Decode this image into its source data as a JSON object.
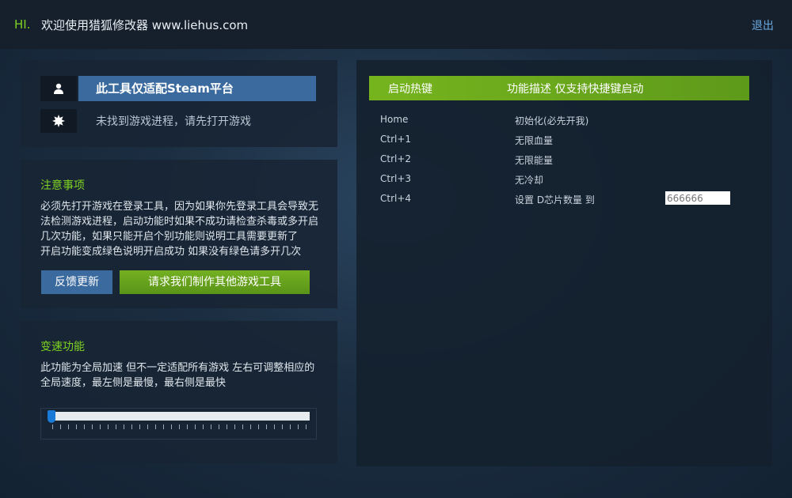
{
  "header": {
    "hi": "HI.",
    "welcome": "欢迎使用猎狐修改器 www.liehus.com",
    "logout": "退出"
  },
  "status": {
    "platform": "此工具仅适配Steam平台",
    "process": "未找到游戏进程，请先打开游戏",
    "user_icon": "user-icon",
    "gear_icon": "gear-icon"
  },
  "notice": {
    "title": "注意事项",
    "lines": [
      "必须先打开游戏在登录工具，因为如果你先登录工具会导致无",
      "法检测游戏进程，启动功能时如果不成功请检查杀毒或多开启",
      "几次功能，如果只能开启个别功能则说明工具需要更新了",
      "开启功能变成绿色说明开启成功 如果没有绿色请多开几次"
    ],
    "feedback_button": "反馈更新",
    "request_button": "请求我们制作其他游戏工具"
  },
  "speed": {
    "title": "变速功能",
    "lines": [
      "此功能为全局加速 但不一定适配所有游戏 左右可调整相应的",
      "全局速度，最左侧是最慢，最右侧是最快"
    ],
    "slider_value": 0
  },
  "hotkeys": {
    "header_key": "启动热键",
    "header_desc": "功能描述 仅支持快捷键启动",
    "rows": [
      {
        "key": "Home",
        "desc": "初始化(必先开我)"
      },
      {
        "key": "Ctrl+1",
        "desc": "无限血量"
      },
      {
        "key": "Ctrl+2",
        "desc": "无限能量"
      },
      {
        "key": "Ctrl+3",
        "desc": "无冷却"
      },
      {
        "key": "Ctrl+4",
        "desc": "设置 D芯片数量 到",
        "input_placeholder": "666666"
      }
    ]
  },
  "colors": {
    "accent_green": "#7ed321",
    "button_blue": "#3a6a9e",
    "link_blue": "#6aa9e0"
  }
}
